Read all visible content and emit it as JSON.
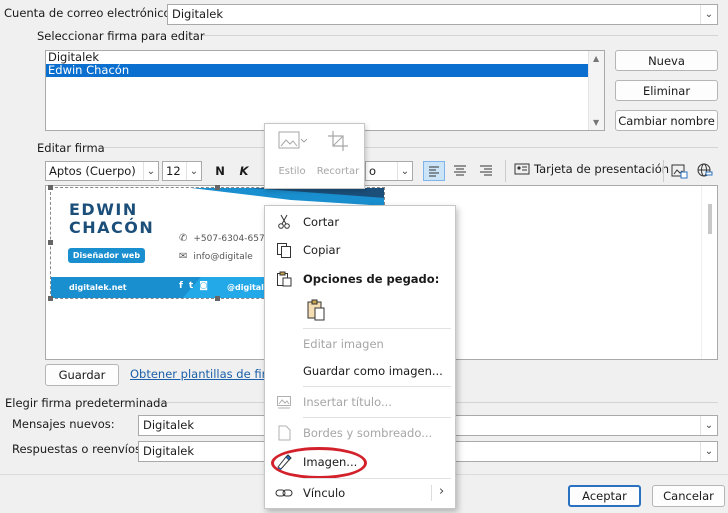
{
  "account": {
    "label": "Cuenta de correo electrónico:",
    "value": "Digitalek"
  },
  "select_signature": {
    "legend": "Seleccionar firma para editar",
    "items": [
      "Digitalek",
      "Edwin Chacón"
    ],
    "selected_index": 1,
    "buttons": {
      "new": "Nueva",
      "delete": "Eliminar",
      "rename": "Cambiar nombre"
    }
  },
  "edit_signature": {
    "legend": "Editar firma",
    "font": "Aptos (Cuerpo)",
    "size": "12",
    "bold": "N",
    "italic": "K",
    "partial_dropdown": "o",
    "business_card": "Tarjeta de presentación",
    "save_button": "Guardar",
    "templates_link": "Obtener plantillas de firma"
  },
  "signature_image": {
    "first_name": "EDWIN",
    "last_name": "CHACÓN",
    "badge": "Diseñador web",
    "phone": "+507-6304-657",
    "email": "info@digitale",
    "website": "digitalek.net",
    "handle": "@digital",
    "accent": "#1a8fcf",
    "dark": "#1b4f7a"
  },
  "mini_toolbar": {
    "style": "Estilo",
    "crop": "Recortar"
  },
  "context_menu": {
    "cut": "Cortar",
    "copy": "Copiar",
    "paste_options": "Opciones de pegado:",
    "edit_image": "Editar imagen",
    "save_as_image": "Guardar como imagen...",
    "insert_title": "Insertar título...",
    "borders": "Bordes y sombreado...",
    "image": "Imagen...",
    "link": "Vínculo"
  },
  "default_signature": {
    "legend": "Elegir firma predeterminada",
    "new_messages_label": "Mensajes nuevos:",
    "new_messages_value": "Digitalek",
    "replies_label": "Respuestas o reenvíos:",
    "replies_value": "Digitalek"
  },
  "dialog_buttons": {
    "ok": "Aceptar",
    "cancel": "Cancelar"
  },
  "highlight_color": "#d3212b"
}
